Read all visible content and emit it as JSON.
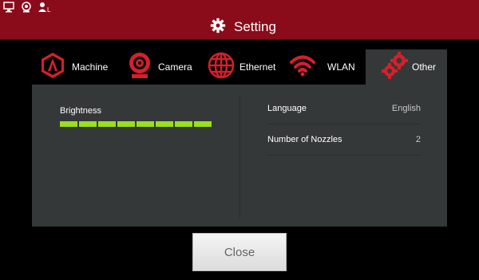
{
  "status_bar": {
    "icons": [
      "monitor-icon",
      "webcam-icon",
      "user-l-icon"
    ]
  },
  "header": {
    "title": "Setting",
    "icon": "gear-icon"
  },
  "tabs": [
    {
      "label": "Machine",
      "icon": "machine-hexagon-icon",
      "active": false
    },
    {
      "label": "Camera",
      "icon": "camera-icon",
      "active": false
    },
    {
      "label": "Ethernet",
      "icon": "globe-icon",
      "active": false
    },
    {
      "label": "WLAN",
      "icon": "wifi-icon",
      "active": false
    },
    {
      "label": "Other",
      "icon": "gears-icon",
      "active": true
    }
  ],
  "brightness": {
    "label": "Brightness",
    "level": 8,
    "max": 8
  },
  "settings": [
    {
      "label": "Language",
      "value": "English"
    },
    {
      "label": "Number of Nozzles",
      "value": "2"
    }
  ],
  "close_label": "Close",
  "colors": {
    "accent": "#8a0b1a",
    "icon_red": "#d5202a",
    "panel": "#353839",
    "brightness_on": "#9be01c"
  }
}
